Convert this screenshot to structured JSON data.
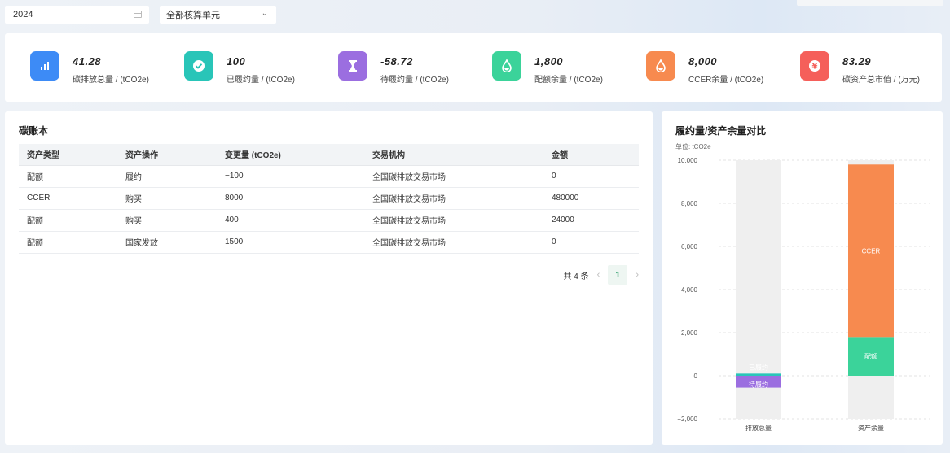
{
  "filters": {
    "year_value": "2024",
    "unit_select_value": "全部核算单元"
  },
  "kpis": [
    {
      "value": "41.28",
      "label": "碳排放总量 / (tCO2e)",
      "color": "#3d8bf6",
      "icon": "bar-chart-icon"
    },
    {
      "value": "100",
      "label": "已履约量 / (tCO2e)",
      "color": "#29c5b8",
      "icon": "check-circle-icon"
    },
    {
      "value": "-58.72",
      "label": "待履约量 / (tCO2e)",
      "color": "#9b6ee0",
      "icon": "hourglass-icon"
    },
    {
      "value": "1,800",
      "label": "配额余量 / (tCO2e)",
      "color": "#3bd39a",
      "icon": "droplet-icon"
    },
    {
      "value": "8,000",
      "label": "CCER余量 / (tCO2e)",
      "color": "#f78a4f",
      "icon": "droplet-icon"
    },
    {
      "value": "83.29",
      "label": "碳资产总市值 / (万元)",
      "color": "#f55f5a",
      "icon": "yen-icon"
    }
  ],
  "ledger": {
    "title": "碳账本",
    "columns": [
      "资产类型",
      "资产操作",
      "变更量 (tCO2e)",
      "交易机构",
      "金额"
    ],
    "rows": [
      [
        "配额",
        "履约",
        "−100",
        "全国碳排放交易市场",
        "0"
      ],
      [
        "CCER",
        "购买",
        "8000",
        "全国碳排放交易市场",
        "480000"
      ],
      [
        "配额",
        "购买",
        "400",
        "全国碳排放交易市场",
        "24000"
      ],
      [
        "配额",
        "国家发放",
        "1500",
        "全国碳排放交易市场",
        "0"
      ]
    ],
    "pagination": {
      "total_text": "共 4 条",
      "current_page": "1"
    }
  },
  "chart_data": {
    "type": "bar",
    "title": "履约量/资产余量对比",
    "unit_label": "单位: tCO2e",
    "categories": [
      "排放总量",
      "资产余量"
    ],
    "ylim": [
      -2000,
      10000
    ],
    "yticks": [
      -2000,
      0,
      2000,
      4000,
      6000,
      8000,
      10000
    ],
    "ytick_labels": [
      "−2,000",
      "0",
      "2,000",
      "4,000",
      "6,000",
      "8,000",
      "10,000"
    ],
    "grid": true,
    "series": [
      {
        "name": "已履约",
        "category": "排放总量",
        "base": 0,
        "value": 100,
        "color": "#29c5b8"
      },
      {
        "name": "待履约",
        "category": "排放总量",
        "base": 0,
        "value": -550,
        "color": "#9b6ee0"
      },
      {
        "name": "配额",
        "category": "资产余量",
        "base": 0,
        "value": 1800,
        "color": "#3bd39a"
      },
      {
        "name": "CCER",
        "category": "资产余量",
        "base": 1800,
        "value": 8000,
        "color": "#f78a4f"
      }
    ],
    "background_bar_color": "#efefef"
  }
}
